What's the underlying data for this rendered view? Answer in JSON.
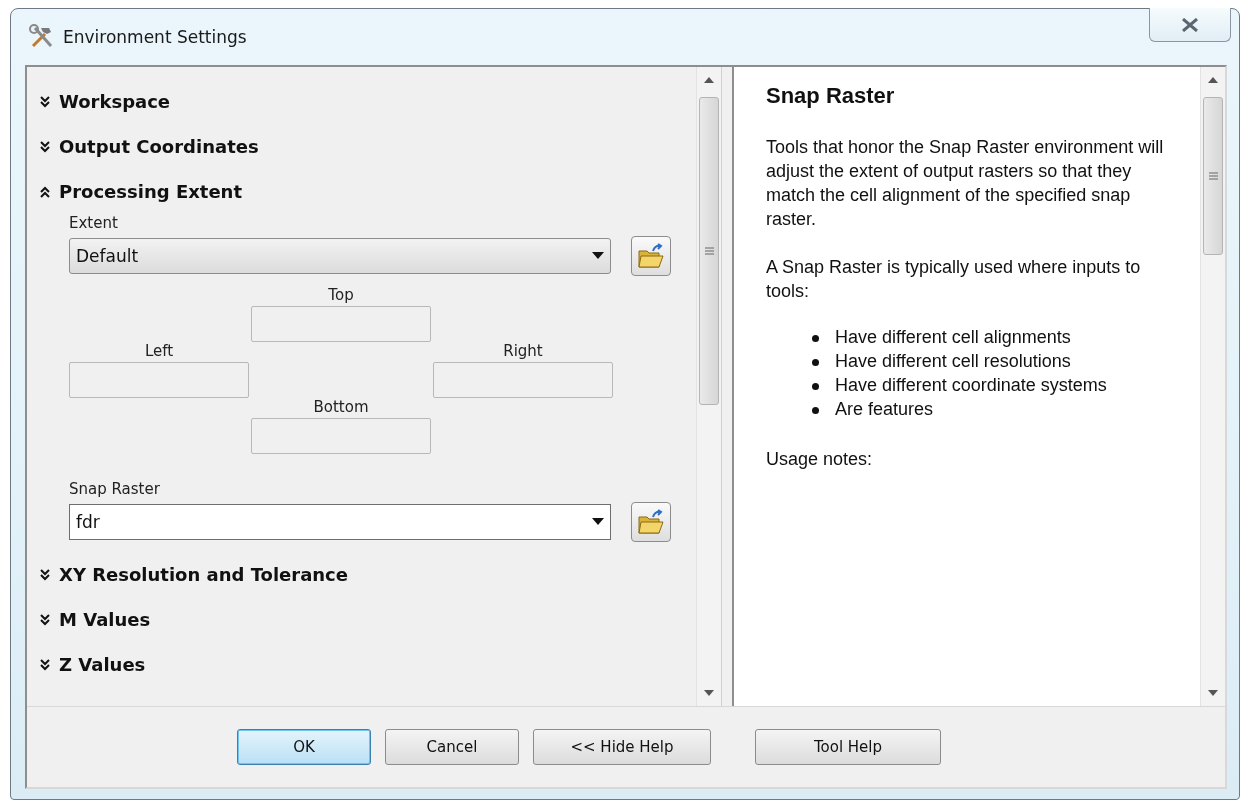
{
  "window": {
    "title": "Environment Settings"
  },
  "sections": [
    {
      "title": "Workspace",
      "expanded": false
    },
    {
      "title": "Output Coordinates",
      "expanded": false
    },
    {
      "title": "Processing Extent",
      "expanded": true,
      "extent": {
        "label": "Extent",
        "value": "Default"
      },
      "bounds": {
        "top": "Top",
        "left": "Left",
        "right": "Right",
        "bottom": "Bottom"
      },
      "snap_raster": {
        "label": "Snap Raster",
        "value": "fdr"
      }
    },
    {
      "title": "XY Resolution and Tolerance",
      "expanded": false
    },
    {
      "title": "M Values",
      "expanded": false
    },
    {
      "title": "Z Values",
      "expanded": false
    }
  ],
  "help": {
    "title": "Snap Raster",
    "blocks": [
      {
        "kind": "paragraph",
        "text": "Tools that honor the Snap Raster environment will adjust the extent of output rasters so that they match the cell alignment of the specified snap raster."
      },
      {
        "kind": "paragraph",
        "text": "A Snap Raster is typically used where inputs to tools:"
      },
      {
        "kind": "bullets",
        "items": [
          "Have different cell alignments",
          "Have different cell resolutions",
          "Have different coordinate systems",
          "Are features"
        ]
      },
      {
        "kind": "paragraph",
        "text": "Usage notes:"
      }
    ]
  },
  "buttons": [
    {
      "label": "OK",
      "default": true
    },
    {
      "label": "Cancel",
      "default": false
    },
    {
      "label": "<< Hide Help",
      "default": false
    },
    {
      "label": "Tool Help",
      "default": false
    }
  ]
}
